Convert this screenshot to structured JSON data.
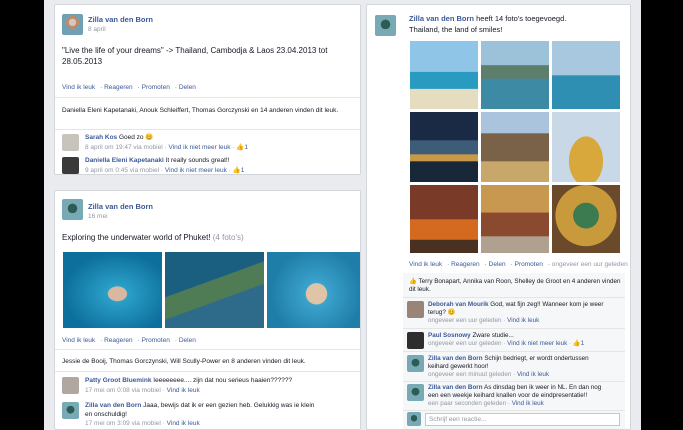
{
  "colors": {
    "link": "#3b5998",
    "background": "#e9ebee"
  },
  "post1": {
    "author": "Zilla van den Born",
    "date": "8 april",
    "text": "\"Live the life of your dreams\" -> Thailand, Cambodja & Laos 23.04.2013 tot 28.05.2013",
    "actions": [
      "Vind ik leuk",
      "Reageren",
      "Promoten",
      "Delen"
    ],
    "likes": "Daniella Eleni Kapetanaki, Anouk Schleiffert, Thomas Gorczynski en 14 anderen vinden dit leuk.",
    "comments": [
      {
        "name": "Sarah Kos",
        "text": "Goed zo 😊",
        "meta": "8 april om 19:47 via mobiel",
        "action": "Vind ik niet meer leuk",
        "likes": "1"
      },
      {
        "name": "Daniella Eleni Kapetanaki",
        "text": "It really sounds great!!",
        "meta": "9 april om 0:45 via mobiel",
        "action": "Vind ik niet meer leuk",
        "likes": "1"
      }
    ]
  },
  "post2": {
    "author": "Zilla van den Born",
    "date": "16 mei",
    "text": "Exploring the underwater world of Phuket!",
    "photo_count": "(4 foto's)",
    "actions": [
      "Vind ik leuk",
      "Reageren",
      "Promoten",
      "Delen"
    ],
    "likes": "Jessie de Booij, Thomas Gorczynski, Will Scully-Power en 8 anderen vinden dit leuk.",
    "comments": [
      {
        "name": "Patty Groot Bluemink",
        "text": "Ieeeeeeee.... zijn dat nou serieus haaien??????",
        "meta": "17 mei om 0:08 via mobiel",
        "action": "Vind ik leuk"
      },
      {
        "name": "Zilla van den Born",
        "text": "Jaaa, bewijs dat ik er een gezien heb. Gelukkig was ie klein",
        "text2": "en onschuldig!",
        "meta": "17 mei om 3:09 via mobiel",
        "action": "Vind ik leuk"
      }
    ]
  },
  "post3": {
    "author": "Zilla van den Born",
    "header_rest": "heeft 14 foto's toegevoegd.",
    "album": "Thailand, the land of smiles!",
    "actions": [
      "Vind ik leuk",
      "Reageren",
      "Delen",
      "Promoten"
    ],
    "time": "ongeveer een uur geleden",
    "likes": "Terry Bonapart, Annika van Roon, Shelley de Groot en 4 anderen vinden dit leuk.",
    "comments": [
      {
        "name": "Deborah van Mourik",
        "text": "God, wat fijn zeg!! Wanneer kom je weer",
        "text2": "terug? 😊",
        "meta": "ongeveer een uur geleden",
        "action": "Vind ik leuk"
      },
      {
        "name": "Paul Sosnowy",
        "text": "Zware studie...",
        "meta": "ongeveer een uur geleden",
        "action": "Vind ik niet meer leuk",
        "likes": "1"
      },
      {
        "name": "Zilla van den Born",
        "text": "Schijn bedriegt, er wordt ondertussen",
        "text2": "keihard gewerkt hoor!",
        "meta": "ongeveer een minuut geleden",
        "action": "Vind ik leuk"
      },
      {
        "name": "Zilla van den Born",
        "text": "As dinsdag ben ik weer in NL. En dan nog",
        "text2": "een een weekje keihard knallen voor de eindpresentatie!!",
        "meta": "een paar seconden geleden",
        "action": "Vind ik leuk"
      }
    ],
    "comment_placeholder": "Schrijf een reactie..."
  }
}
